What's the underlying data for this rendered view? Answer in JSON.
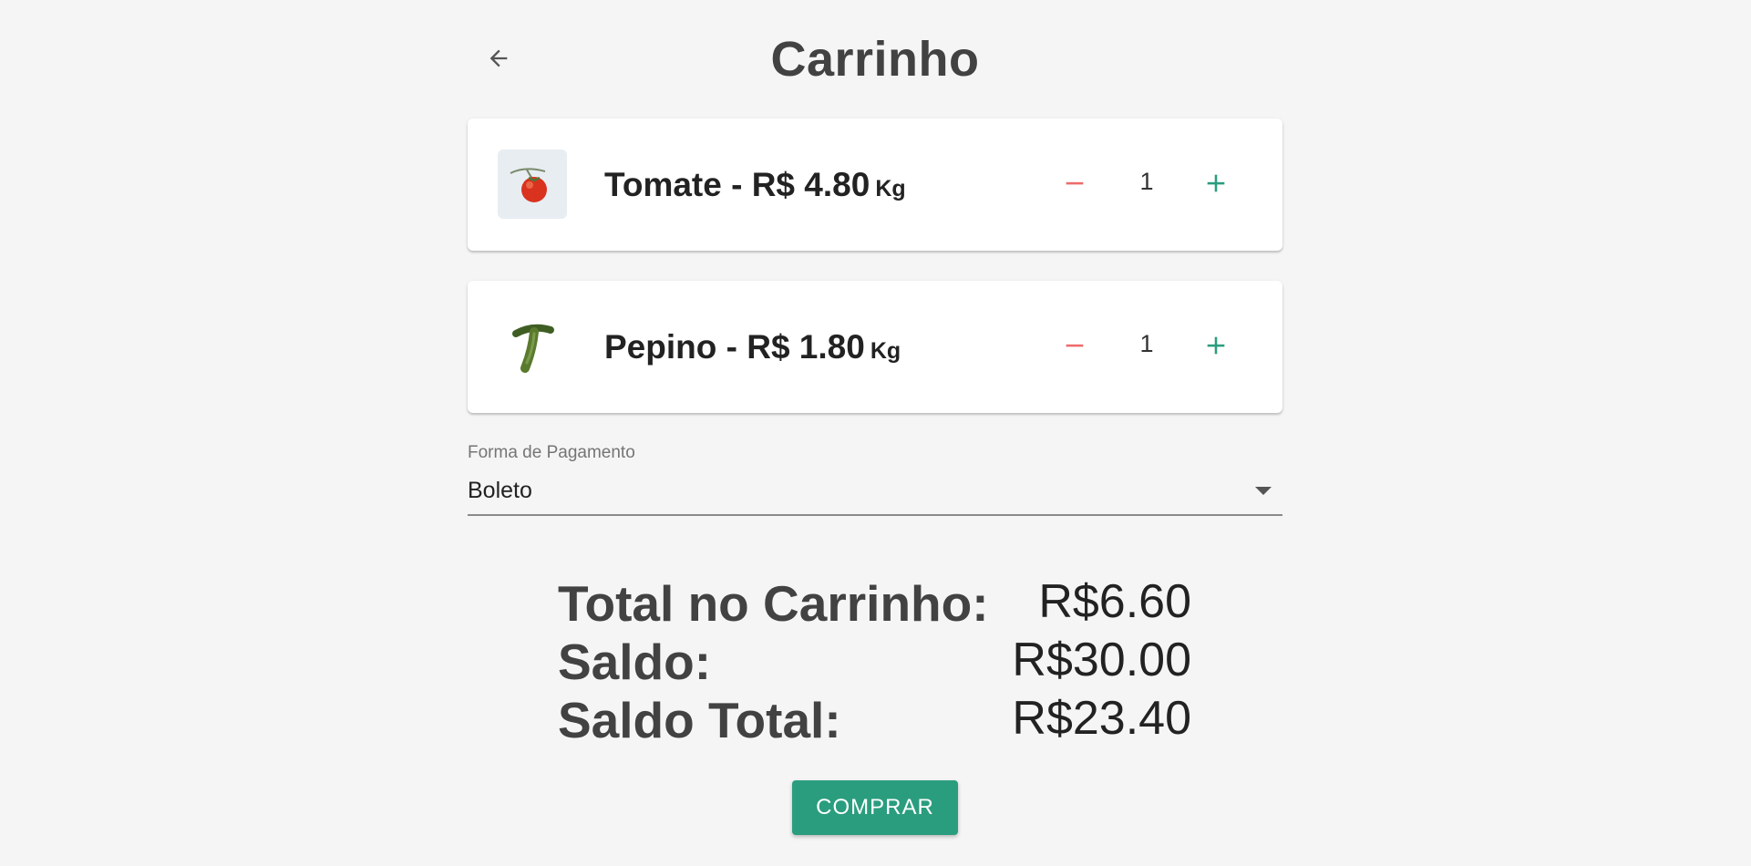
{
  "header": {
    "title": "Carrinho",
    "back_icon": "arrow-left-icon"
  },
  "cart": {
    "items": [
      {
        "name_price": "Tomate - R$ 4.80",
        "unit": "Kg",
        "quantity": "1",
        "image_icon": "tomato-icon"
      },
      {
        "name_price": "Pepino - R$ 1.80",
        "unit": "Kg",
        "quantity": "1",
        "image_icon": "cucumber-icon"
      }
    ]
  },
  "payment": {
    "label": "Forma de Pagamento",
    "selected": "Boleto"
  },
  "totals": {
    "cart_total_label": "Total no Carrinho:",
    "cart_total_value": "R$6.60",
    "balance_label": "Saldo:",
    "balance_value": "R$30.00",
    "final_balance_label": "Saldo Total:",
    "final_balance_value": "R$23.40"
  },
  "actions": {
    "buy_label": "COMPRAR"
  },
  "colors": {
    "accent": "#2a9d7e",
    "minus": "#ef6b6b",
    "background": "#f5f5f5",
    "title": "#424242"
  }
}
